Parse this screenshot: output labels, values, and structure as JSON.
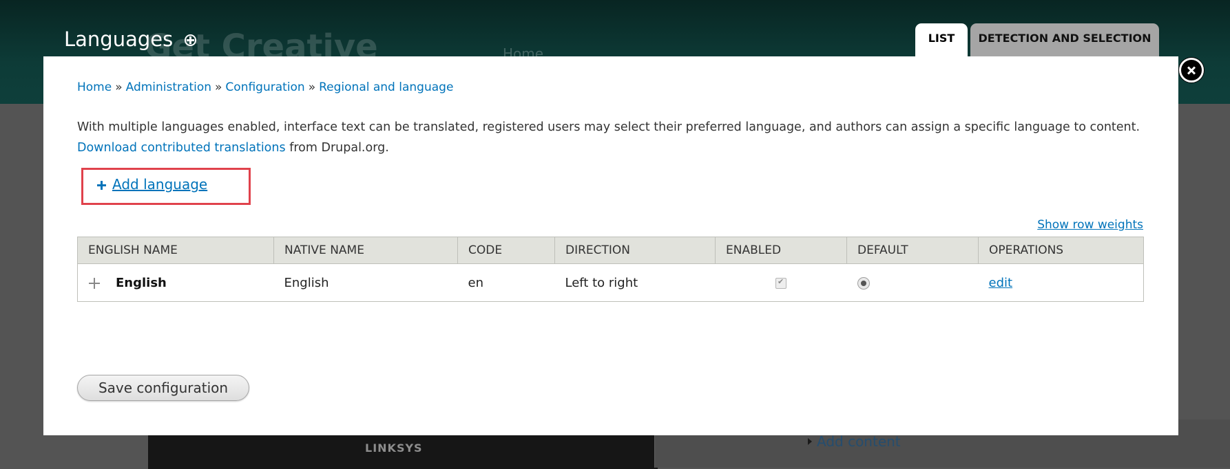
{
  "background": {
    "site_name": "Get Creative",
    "nav_home": "Home",
    "product_brand": "LINKSYS",
    "add_content": "Add content"
  },
  "overlay": {
    "title": "Languages",
    "tabs": [
      {
        "label": "LIST",
        "active": true
      },
      {
        "label": "DETECTION AND SELECTION",
        "active": false
      }
    ]
  },
  "breadcrumb": [
    "Home",
    "Administration",
    "Configuration",
    "Regional and language"
  ],
  "breadcrumb_separator": "»",
  "description": {
    "text": "With multiple languages enabled, interface text can be translated, registered users may select their preferred language, and authors can assign a specific language to content.",
    "link_text": "Download contributed translations",
    "suffix": "from Drupal.org."
  },
  "add_language_label": "Add language",
  "show_row_weights": "Show row weights",
  "table": {
    "headers": [
      "ENGLISH NAME",
      "NATIVE NAME",
      "CODE",
      "DIRECTION",
      "ENABLED",
      "DEFAULT",
      "OPERATIONS"
    ],
    "rows": [
      {
        "english_name": "English",
        "native_name": "English",
        "code": "en",
        "direction": "Left to right",
        "enabled": true,
        "default": true,
        "operation": "edit"
      }
    ]
  },
  "save_button": "Save configuration",
  "colors": {
    "link": "#0073ba",
    "highlight_border": "#e0424c",
    "header_bg": "#0d3b37",
    "table_header_bg": "#e1e2dc"
  },
  "icons": {
    "shortcut": "circle-plus-icon",
    "close": "close-icon",
    "add": "plus-icon",
    "drag": "drag-handle-icon"
  }
}
